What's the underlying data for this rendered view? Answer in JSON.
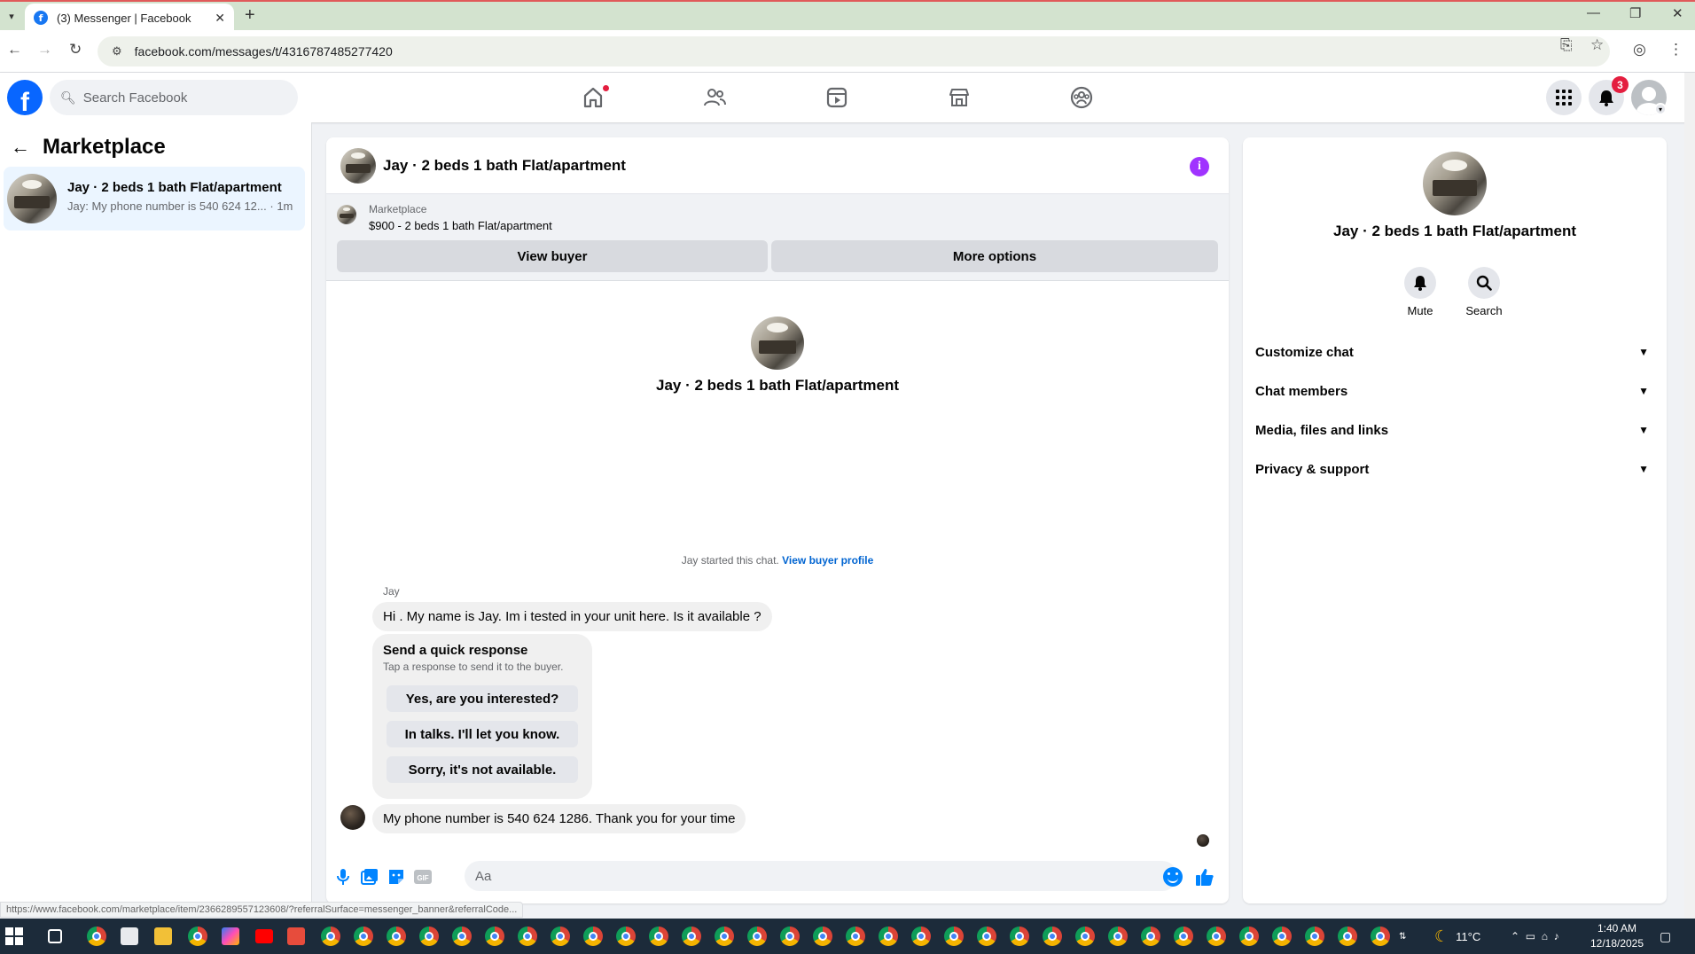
{
  "browser": {
    "tab_title": "(3) Messenger | Facebook",
    "url": "facebook.com/messages/t/4316787485277420",
    "status_url": "https://www.facebook.com/marketplace/item/2366289557123608/?referralSurface=messenger_banner&referralCode..."
  },
  "fb_header": {
    "search_placeholder": "Search Facebook",
    "notification_count": "3"
  },
  "left_panel": {
    "title": "Marketplace",
    "conversations": [
      {
        "name": "Jay · 2 beds 1 bath Flat/apartment",
        "preview": "Jay: My phone number is 540 624 12...",
        "time": "· 1m"
      }
    ]
  },
  "chat": {
    "title": "Jay · 2 beds 1 bath Flat/apartment",
    "marketplace_label": "Marketplace",
    "item": "$900 - 2 beds 1 bath Flat/apartment",
    "view_buyer_label": "View buyer",
    "more_options_label": "More options",
    "intro_name": "Jay · 2 beds 1 bath Flat/apartment",
    "started_text": "Jay started this chat.",
    "view_buyer_profile": "View buyer profile",
    "sender_name": "Jay",
    "message_1": "Hi . My name is Jay. Im i tested in your unit here. Is it available ?",
    "quick_response": {
      "title": "Send a quick response",
      "subtitle": "Tap a response to send it to the buyer.",
      "options": [
        "Yes, are you interested?",
        "In talks. I'll let you know.",
        "Sorry, it's not available."
      ]
    },
    "message_2": "My phone number is 540 624 1286. Thank you for your time",
    "composer_placeholder": "Aa"
  },
  "right_panel": {
    "name": "Jay · 2 beds 1 bath Flat/apartment",
    "actions": [
      {
        "label": "Mute",
        "icon": "bell-icon"
      },
      {
        "label": "Search",
        "icon": "search-icon"
      }
    ],
    "sections": [
      "Customize chat",
      "Chat members",
      "Media, files and links",
      "Privacy & support"
    ]
  },
  "taskbar": {
    "weather": "11°C",
    "time": "1:40 AM",
    "date": "12/18/2025"
  },
  "colors": {
    "accent": "#0866ff",
    "messenger_blue": "#0084ff",
    "info_purple": "#a033ff",
    "notification_red": "#e41e3f"
  }
}
